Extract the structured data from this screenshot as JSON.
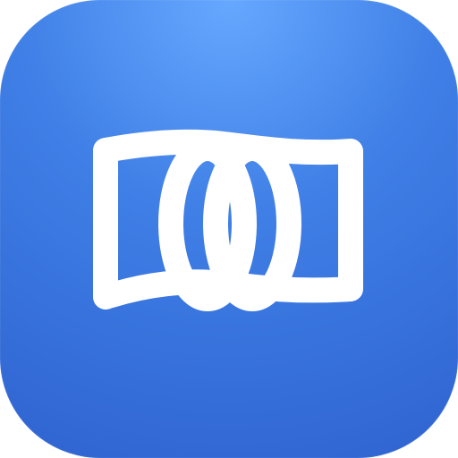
{
  "app_icon": {
    "icon_name": "banknote-money-icon",
    "colors": {
      "gradient_light": "#66a8ff",
      "gradient_mid": "#3f7fe6",
      "gradient_dark": "#2f63d0",
      "glyph": "#ffffff"
    }
  }
}
